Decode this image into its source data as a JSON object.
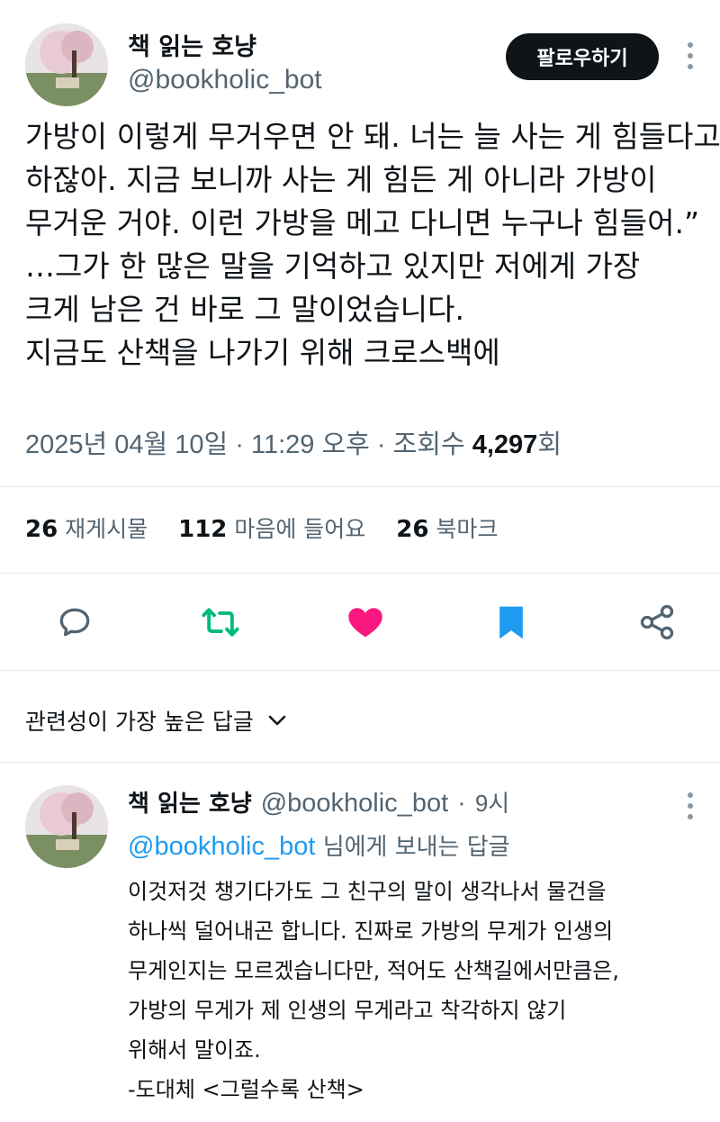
{
  "tweet": {
    "author": {
      "display_name": "책 읽는 호냥",
      "handle": "@bookholic_bot"
    },
    "follow_label": "팔로우하기",
    "text_lines": [
      "가방이 이렇게 무거우면 안 돼. 너는 늘 사는 게 힘들다고",
      "하잖아. 지금 보니까 사는 게 힘든 게 아니라 가방이",
      "무거운 거야. 이런 가방을 메고 다니면 누구나 힘들어.”",
      "…그가 한 많은 말을 기억하고 있지만 저에게 가장",
      "크게 남은 건 바로 그 말이었습니다.",
      "지금도 산책을 나가기 위해 크로스백에"
    ],
    "meta": {
      "date": "2025년 04월 10일",
      "sep1": "·",
      "time": "11:29 오후",
      "sep2": "·",
      "views_label": "조회수",
      "views": "4,297",
      "views_suffix": "회"
    },
    "stats": {
      "retweets": "26",
      "retweets_label": "재게시물",
      "likes": "112",
      "likes_label": "마음에 들어요",
      "bookmarks": "26",
      "bookmarks_label": "북마크"
    },
    "actions": [
      {
        "icon": "reply-icon"
      },
      {
        "icon": "retweet-icon"
      },
      {
        "icon": "heart-icon",
        "active": true
      },
      {
        "icon": "bookmark-icon",
        "active": true
      },
      {
        "icon": "share-icon"
      }
    ]
  },
  "replies_sort": {
    "label": "관련성이 가장 높은 답글"
  },
  "reply": {
    "display_name": "책 읽는 호냥",
    "handle": "@bookholic_bot",
    "sep": "·",
    "time": "9시",
    "replying_to_handle": "@bookholic_bot",
    "replying_to_suffix": "님에게 보내는 답글",
    "text_lines": [
      "이것저것 챙기다가도 그 친구의 말이 생각나서 물건을",
      "하나씩 덜어내곤 합니다. 진짜로 가방의 무게가 인생의",
      "무게인지는 모르겠습니다만, 적어도 산책길에서만큼은,",
      "가방의 무게가 제 인생의 무게라고 착각하지 않기",
      "위해서 말이죠.",
      "-도대체 <그럴수록 산책>"
    ]
  },
  "colors": {
    "text": "#0f1419",
    "secondary": "#536471",
    "link": "#1d9bf0",
    "retweet": "#00ba7c",
    "like": "#f91880",
    "bookmark": "#1d9bf0",
    "follow_bg": "#0f1419"
  }
}
